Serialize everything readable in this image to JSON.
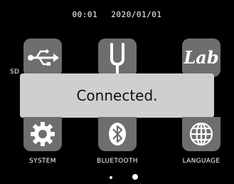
{
  "status_bar": {
    "time": "00:01",
    "date": "2020/01/01"
  },
  "menu": {
    "items": [
      {
        "id": "sd",
        "label": "SD",
        "icon": "usb-icon"
      },
      {
        "id": "tuner",
        "label": "",
        "icon": "tuning-fork-icon"
      },
      {
        "id": "lab",
        "label": "",
        "icon": "lab-icon",
        "icon_text": "Lab"
      },
      {
        "id": "system",
        "label": "SYSTEM",
        "icon": "gear-icon"
      },
      {
        "id": "bluetooth",
        "label": "BLUETOOTH",
        "icon": "bluetooth-icon"
      },
      {
        "id": "language",
        "label": "LANGUAGE",
        "icon": "globe-icon"
      }
    ]
  },
  "toast": {
    "message": "Connected."
  },
  "pagination": {
    "pages": 2,
    "current": 2
  },
  "colors": {
    "background": "#000000",
    "tile": "#6e6e6e",
    "toast": "#cfcfcf",
    "text": "#ffffff"
  }
}
